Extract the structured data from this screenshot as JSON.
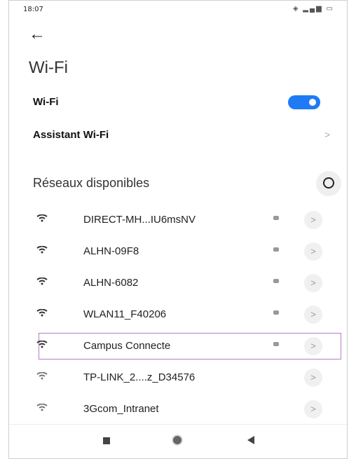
{
  "status_bar": {
    "time": "18:07",
    "icons": "◈ ▂▄▆ ▭"
  },
  "header": {
    "back_icon": "←",
    "title": "Wi-Fi"
  },
  "wifi_toggle": {
    "label": "Wi-Fi",
    "enabled": true
  },
  "assistant": {
    "label": "Assistant Wi-Fi",
    "chevron": ">"
  },
  "networks_section": {
    "title": "Réseaux disponibles"
  },
  "networks": [
    {
      "name": "DIRECT-MH...IU6msNV",
      "secured": true,
      "chevron": ">"
    },
    {
      "name": "ALHN-09F8",
      "secured": true,
      "chevron": ">"
    },
    {
      "name": "ALHN-6082",
      "secured": true,
      "chevron": ">"
    },
    {
      "name": "WLAN11_F40206",
      "secured": true,
      "chevron": ">"
    },
    {
      "name": "Campus Connecte",
      "secured": true,
      "chevron": ">",
      "highlighted": true
    },
    {
      "name": "TP-LINK_2....z_D34576",
      "secured": false,
      "chevron": ">"
    },
    {
      "name": "3Gcom_Intranet",
      "secured": false,
      "chevron": ">"
    }
  ],
  "colors": {
    "accent": "#1e7bf5",
    "highlight_border": "#b77cc7"
  }
}
